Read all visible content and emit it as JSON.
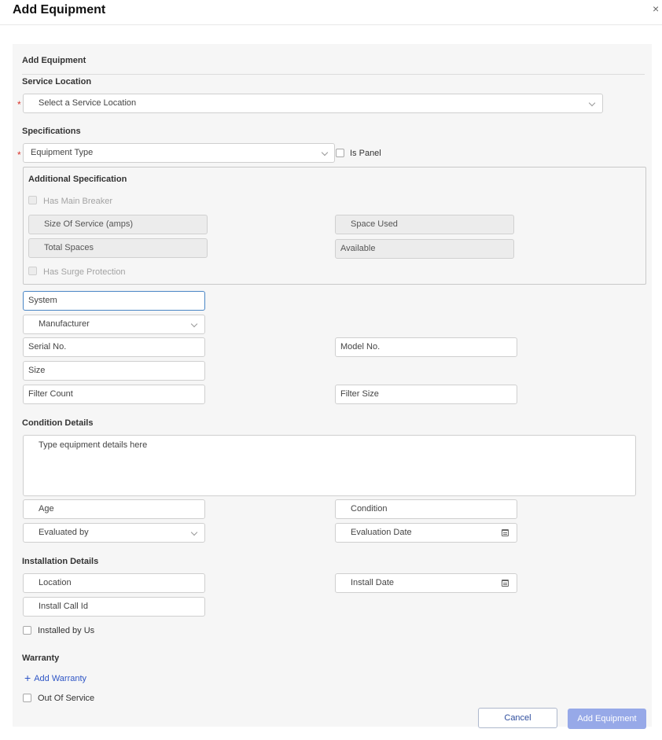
{
  "dialog": {
    "title": "Add Equipment",
    "close_glyph": "×"
  },
  "form": {
    "heading": "Add Equipment",
    "service_location": {
      "label": "Service Location",
      "placeholder": "Select a Service Location"
    },
    "specifications": {
      "label": "Specifications",
      "equipment_type": "Equipment Type",
      "is_panel": "Is Panel"
    },
    "additional_specification": {
      "title": "Additional Specification",
      "has_main_breaker": "Has Main Breaker",
      "size_of_service": "Size Of Service (amps)",
      "space_used": "Space Used",
      "total_spaces": "Total Spaces",
      "available": "Available",
      "has_surge_protection": "Has Surge Protection"
    },
    "system": "System",
    "manufacturer": "Manufacturer",
    "serial_no": "Serial No.",
    "model_no": "Model No.",
    "size": "Size",
    "filter_count": "Filter Count",
    "filter_size": "Filter Size",
    "condition_details": {
      "label": "Condition Details",
      "details_placeholder": "Type equipment details here",
      "age": "Age",
      "condition": "Condition",
      "evaluated_by": "Evaluated by",
      "evaluation_date": "Evaluation Date"
    },
    "installation_details": {
      "label": "Installation Details",
      "location": "Location",
      "install_date": "Install Date",
      "install_call_id": "Install Call Id",
      "installed_by_us": "Installed by Us"
    },
    "warranty": {
      "label": "Warranty",
      "add_link": "Add Warranty",
      "plus": "+"
    },
    "out_of_service": "Out Of Service",
    "required_mark": "*"
  },
  "footer": {
    "cancel": "Cancel",
    "submit": "Add Equipment"
  },
  "colors": {
    "accent": "#2f56c6",
    "primary_button": "#97a9e8",
    "required": "#d9342b",
    "focus_border": "#4a86c5"
  }
}
